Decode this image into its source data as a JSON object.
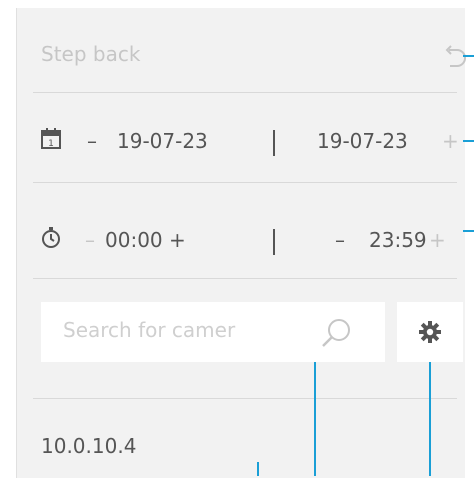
{
  "step_back": {
    "label": "Step back",
    "icon": "undo-icon"
  },
  "date_range": {
    "icon": "calendar-icon",
    "start": {
      "minus": "–",
      "value": "19-07-23"
    },
    "separator": "|",
    "end": {
      "value": "19-07-23",
      "plus": "+"
    }
  },
  "time_range": {
    "icon": "stopwatch-icon",
    "start": {
      "minus": "–",
      "value": "00:00",
      "plus": "+"
    },
    "separator": "|",
    "end": {
      "minus": "–",
      "value": "23:59",
      "plus": "+"
    }
  },
  "search": {
    "placeholder": "Search for camer",
    "icon": "search-icon"
  },
  "settings": {
    "icon": "gear-icon"
  },
  "camera_list": [
    {
      "label": "10.0.10.4"
    }
  ],
  "colors": {
    "panel_bg": "#f2f2f2",
    "text_dark": "#555555",
    "text_muted": "#c6c6c6",
    "callout_blue": "#1a9fd6"
  }
}
